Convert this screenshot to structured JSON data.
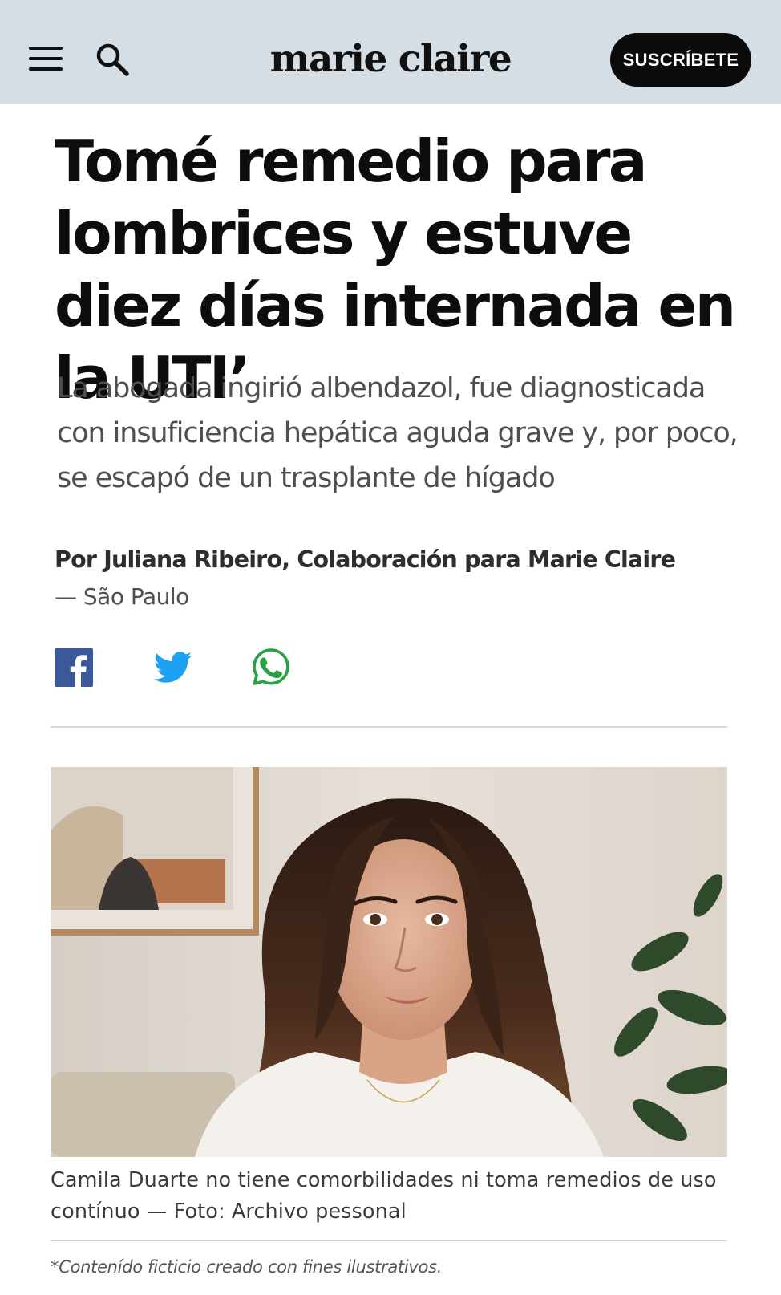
{
  "header": {
    "brand": "marie claire",
    "subscribe_label": "SUSCRÍBETE",
    "icons": {
      "menu": "hamburger-menu-icon",
      "search": "search-icon"
    }
  },
  "article": {
    "headline": "Tomé remedio para lombrices y estuve diez días internada en la UTI’",
    "subheadline": "La abogada ingirió albendazol, fue diagnosticada con insuficiencia hepática aguda grave y, por poco, se escapó de un trasplante de hígado",
    "byline": "Por Juliana Ribeiro, Colaboración para Marie Claire",
    "location": "— São Paulo",
    "share": [
      {
        "network": "facebook",
        "icon": "facebook-icon",
        "color": "#3b5998"
      },
      {
        "network": "twitter",
        "icon": "twitter-icon",
        "color": "#1da1f2"
      },
      {
        "network": "whatsapp",
        "icon": "whatsapp-icon",
        "color": "#25a244"
      }
    ],
    "image": {
      "caption": "Camila Duarte no tiene comorbilidades ni toma remedios de uso contínuo — Foto: Archivo pessonal"
    },
    "disclaimer": "*Contenído ficticio creado con fines ilustrativos."
  }
}
